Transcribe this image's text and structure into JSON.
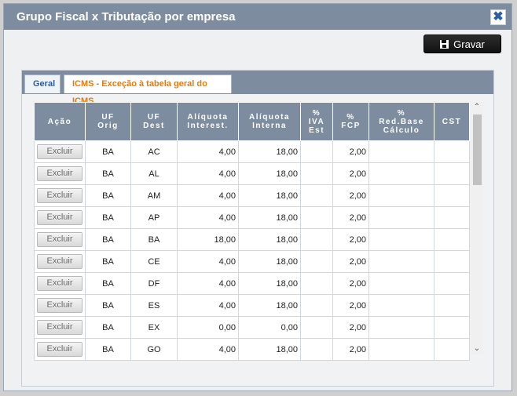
{
  "dialog": {
    "title": "Grupo Fiscal x Tributação por empresa",
    "close_symbol": "✖",
    "save_label": "Gravar"
  },
  "tabs": [
    {
      "label": "Geral"
    },
    {
      "label": "ICMS - Exceção à tabela geral do ICMS"
    }
  ],
  "table": {
    "headers": [
      {
        "l1": "Ação",
        "l2": "",
        "l3": ""
      },
      {
        "l1": "UF",
        "l2": "Orig",
        "l3": ""
      },
      {
        "l1": "UF",
        "l2": "Dest",
        "l3": ""
      },
      {
        "l1": "Alíquota",
        "l2": "Interest.",
        "l3": ""
      },
      {
        "l1": "Alíquota",
        "l2": "Interna",
        "l3": ""
      },
      {
        "l1": "%",
        "l2": "IVA",
        "l3": "Est"
      },
      {
        "l1": "%",
        "l2": "FCP",
        "l3": ""
      },
      {
        "l1": "%",
        "l2": "Red.Base",
        "l3": "Cálculo"
      },
      {
        "l1": "CST",
        "l2": "",
        "l3": ""
      }
    ],
    "delete_label": "Excluir",
    "rows": [
      {
        "orig": "BA",
        "dest": "AC",
        "inter": "4,00",
        "interna": "18,00",
        "iva": "",
        "fcp": "2,00",
        "red": "",
        "cst": ""
      },
      {
        "orig": "BA",
        "dest": "AL",
        "inter": "4,00",
        "interna": "18,00",
        "iva": "",
        "fcp": "2,00",
        "red": "",
        "cst": ""
      },
      {
        "orig": "BA",
        "dest": "AM",
        "inter": "4,00",
        "interna": "18,00",
        "iva": "",
        "fcp": "2,00",
        "red": "",
        "cst": ""
      },
      {
        "orig": "BA",
        "dest": "AP",
        "inter": "4,00",
        "interna": "18,00",
        "iva": "",
        "fcp": "2,00",
        "red": "",
        "cst": ""
      },
      {
        "orig": "BA",
        "dest": "BA",
        "inter": "18,00",
        "interna": "18,00",
        "iva": "",
        "fcp": "2,00",
        "red": "",
        "cst": ""
      },
      {
        "orig": "BA",
        "dest": "CE",
        "inter": "4,00",
        "interna": "18,00",
        "iva": "",
        "fcp": "2,00",
        "red": "",
        "cst": ""
      },
      {
        "orig": "BA",
        "dest": "DF",
        "inter": "4,00",
        "interna": "18,00",
        "iva": "",
        "fcp": "2,00",
        "red": "",
        "cst": ""
      },
      {
        "orig": "BA",
        "dest": "ES",
        "inter": "4,00",
        "interna": "18,00",
        "iva": "",
        "fcp": "2,00",
        "red": "",
        "cst": ""
      },
      {
        "orig": "BA",
        "dest": "EX",
        "inter": "0,00",
        "interna": "0,00",
        "iva": "",
        "fcp": "2,00",
        "red": "",
        "cst": ""
      },
      {
        "orig": "BA",
        "dest": "GO",
        "inter": "4,00",
        "interna": "18,00",
        "iva": "",
        "fcp": "2,00",
        "red": "",
        "cst": ""
      }
    ]
  },
  "scrollbar": {
    "up_symbol": "⌃",
    "down_symbol": "⌄"
  },
  "colors": {
    "header": "#7d8c9e",
    "tab_active_text": "#e07d10",
    "tab_text": "#2c5aa0"
  }
}
